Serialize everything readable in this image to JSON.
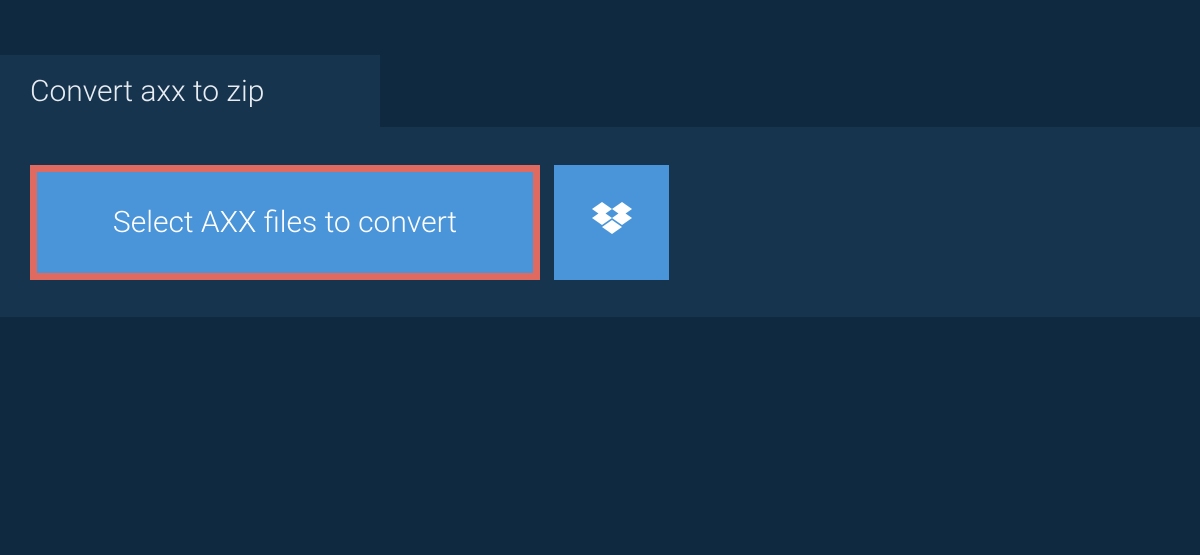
{
  "tab": {
    "title": "Convert axx to zip"
  },
  "actions": {
    "select_files_label": "Select AXX files to convert"
  },
  "colors": {
    "bg": "#0f2940",
    "panel": "#17344f",
    "button": "#4a95d9",
    "highlight_border": "#e06a5f",
    "text": "#e8edf2"
  }
}
